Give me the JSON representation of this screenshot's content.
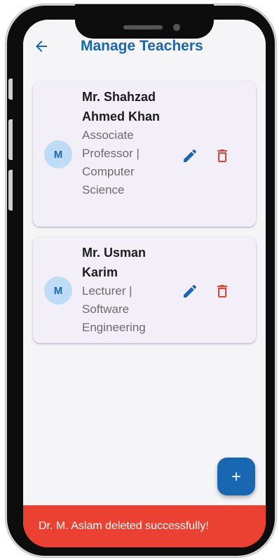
{
  "appbar": {
    "title": "Manage Teachers",
    "back_icon": "arrow-back-icon"
  },
  "teachers": [
    {
      "initial": "M",
      "name": "Mr. Shahzad Ahmed Khan",
      "subtitle": "Associate Professor | Computer Science",
      "edit_icon": "edit-icon",
      "delete_icon": "delete-icon"
    },
    {
      "initial": "M",
      "name": "Mr. Usman Karim",
      "subtitle": "Lecturer | Software Engineering",
      "edit_icon": "edit-icon",
      "delete_icon": "delete-icon"
    }
  ],
  "fab": {
    "icon": "plus-icon"
  },
  "snackbar": {
    "message": "Dr. M. Aslam deleted successfully!"
  },
  "colors": {
    "primary": "#1967b0",
    "card_bg": "#f3eff8",
    "avatar_bg": "#bfdcf7",
    "delete_red": "#eb4133",
    "snackbar_bg": "#eb4133",
    "screen_bg": "#f5f5f7"
  }
}
